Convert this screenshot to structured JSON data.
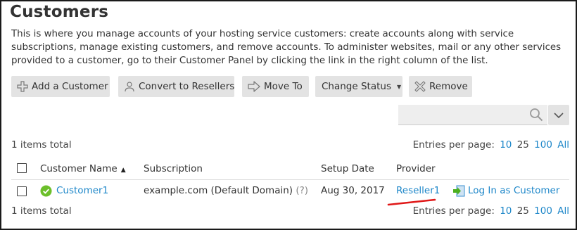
{
  "page": {
    "title": "Customers",
    "description": "This is where you manage accounts of your hosting service customers: create accounts along with service subscriptions, manage existing customers, and remove accounts. To administer websites, mail or any other services provided to a customer, go to their Customer Panel by clicking the link in the right column of the list."
  },
  "toolbar": {
    "add_customer": "Add a Customer",
    "convert_to_resellers": "Convert to Resellers",
    "move_to": "Move To",
    "change_status": "Change Status",
    "remove": "Remove"
  },
  "search": {
    "placeholder": ""
  },
  "list": {
    "items_total": "1 items total",
    "entries_per_page_label": "Entries per page:",
    "entries_options": [
      "10",
      "25",
      "100",
      "All"
    ],
    "columns": [
      "Customer Name",
      "Subscription",
      "Setup Date",
      "Provider"
    ],
    "rows": [
      {
        "status": "active",
        "customer_name": "Customer1",
        "subscription": "example.com (Default Domain)",
        "subscription_hint": "(?)",
        "setup_date": "Aug 30, 2017",
        "provider": "Reseller1",
        "action": "Log In as Customer"
      }
    ]
  },
  "colors": {
    "link": "#1e87c9",
    "button_bg": "#e3e3e3",
    "status_ok": "#6cbf2a",
    "annotation_red": "#e01818"
  },
  "icons": {
    "add_customer": "plus-icon",
    "convert": "person-icon",
    "move_to": "arrow-right-icon",
    "change_status": "chevron-down-icon",
    "remove": "x-icon",
    "search": "search-icon",
    "login": "login-icon",
    "status": "checkmark-circle-icon"
  }
}
